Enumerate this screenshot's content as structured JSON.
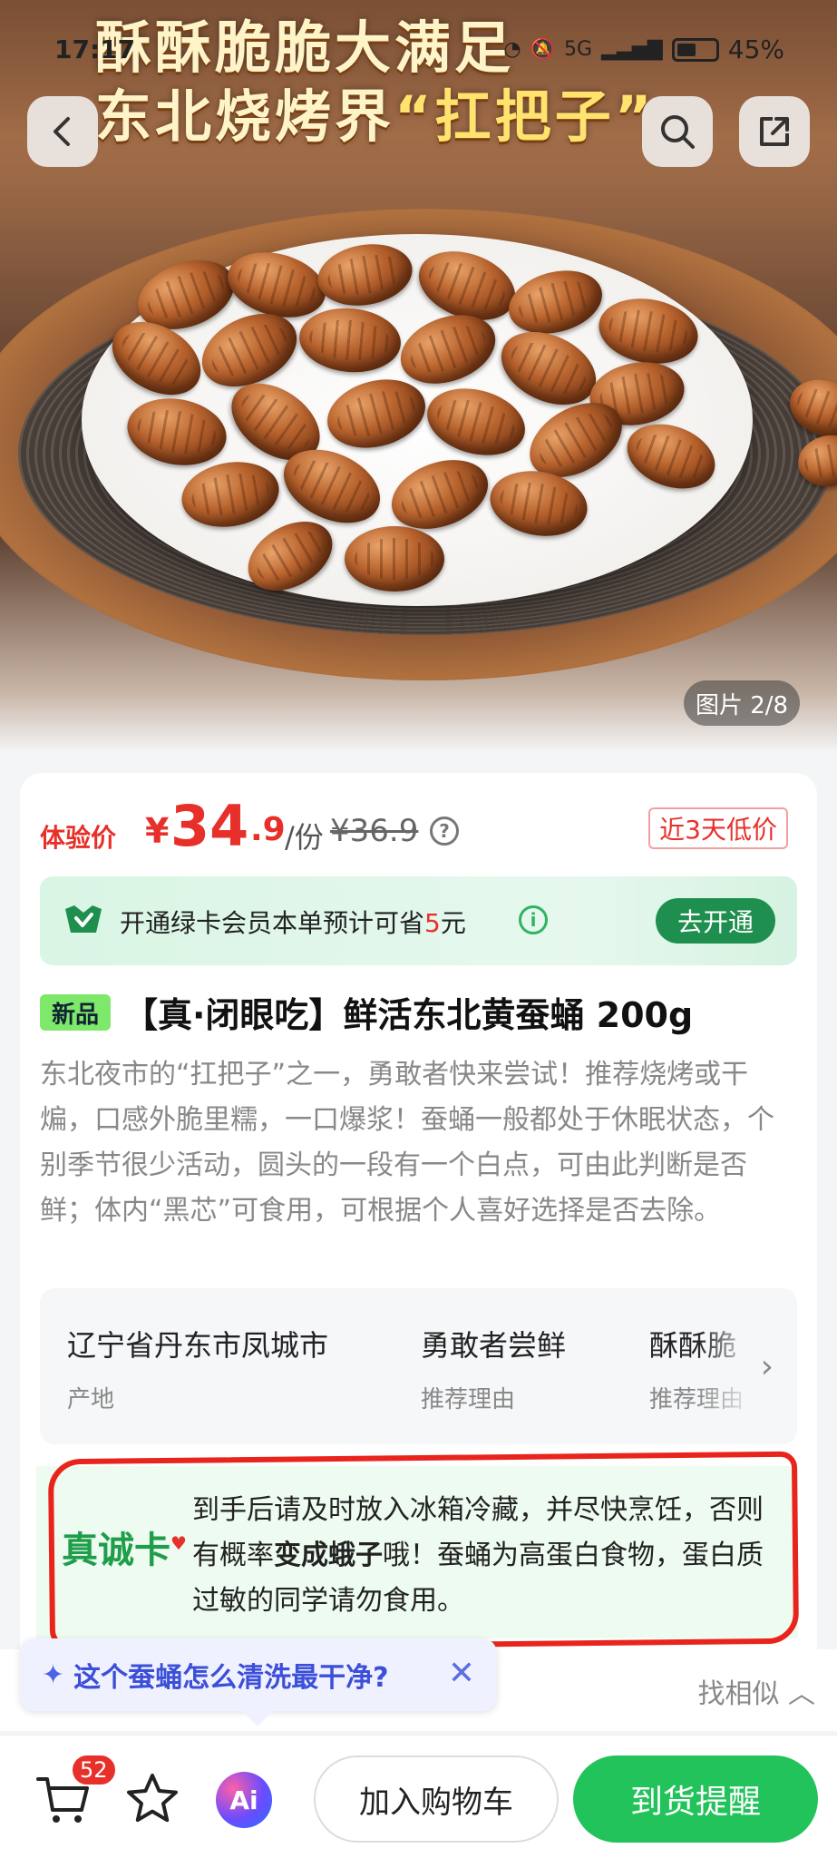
{
  "status_bar": {
    "time": "17:17",
    "network": "5G",
    "battery": "45%"
  },
  "hero": {
    "banner_line1": "酥酥脆脆大满足",
    "banner_line2_prefix": "东北烧烤界",
    "banner_line2_highlight": "“扛把子”",
    "image_counter": "图片 2/8"
  },
  "price": {
    "label": "体验价",
    "currency": "¥",
    "integer": "34",
    "decimal": ".9",
    "unit": "/份",
    "original": "¥36.9",
    "low_badge": "近3天低价"
  },
  "member": {
    "text_prefix": "开通绿卡会员本单预计可省",
    "save_amount": "5",
    "text_suffix": "元",
    "open_button": "去开通"
  },
  "product": {
    "tag": "新品",
    "title": "【真·闭眼吃】鲜活东北黄蚕蛹 200g",
    "description": "东北夜市的“扛把子”之一，勇敢者快来尝试！推荐烧烤或干煸，口感外脆里糯，一口爆浆！蚕蛹一般都处于休眠状态，个别季节很少活动，圆头的一段有一个白点，可由此判断是否鲜；体内“黑芯”可食用，可根据个人喜好选择是否去除。"
  },
  "attributes": [
    {
      "value": "辽宁省丹东市凤城市",
      "key": "产地"
    },
    {
      "value": "勇敢者尝鲜",
      "key": "推荐理由"
    },
    {
      "value": "酥酥脆",
      "key": "推荐理由"
    }
  ],
  "notice": {
    "logo": "真诚卡",
    "text_part1": "到手后请及时放入冰箱冷藏，并尽快烹饪，否则有概率",
    "text_bold": "变成蛾子",
    "text_part2": "哦！蚕蛹为高蛋白食物，蛋白质过敏的同学请勿食用。"
  },
  "ai_tip": {
    "question": "这个蚕蛹怎么清洗最干净?"
  },
  "similar": {
    "label": "找相似"
  },
  "bottom_bar": {
    "cart_count": "52",
    "ai_label": "Ai",
    "add_to_cart": "加入购物车",
    "notify": "到货提醒"
  },
  "colors": {
    "price_red": "#e8302a",
    "member_green": "#1e8f4e",
    "notify_green": "#22c35a",
    "ai_blue": "#3b4fd8",
    "outline_red": "#e8241c"
  }
}
